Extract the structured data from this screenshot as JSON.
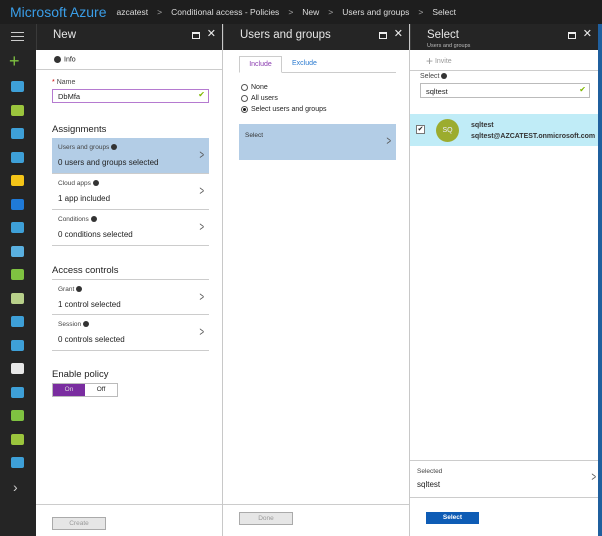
{
  "topbar": {
    "brand": "Microsoft Azure",
    "breadcrumbs": [
      "azcatest",
      "Conditional access - Policies",
      "New",
      "Users and groups",
      "Select"
    ]
  },
  "sidebar": {
    "icons": [
      {
        "name": "dashboard-icon",
        "color": "#3ea0d8"
      },
      {
        "name": "all-resources-icon",
        "color": "#9bc53d"
      },
      {
        "name": "resource-groups-icon",
        "color": "#3ea0d8"
      },
      {
        "name": "app-services-icon",
        "color": "#3ea0d8"
      },
      {
        "name": "function-apps-icon",
        "color": "#f5c518"
      },
      {
        "name": "sql-databases-icon",
        "color": "#1f7ad8"
      },
      {
        "name": "cosmos-db-icon",
        "color": "#3ea0d8"
      },
      {
        "name": "virtual-machines-icon",
        "color": "#5ab0e0"
      },
      {
        "name": "load-balancers-icon",
        "color": "#7fc241"
      },
      {
        "name": "storage-accounts-icon",
        "color": "#b8d08a"
      },
      {
        "name": "virtual-networks-icon",
        "color": "#3ea0d8"
      },
      {
        "name": "azure-ad-icon",
        "color": "#3ea0d8"
      },
      {
        "name": "monitor-icon",
        "color": "#e8e8e8"
      },
      {
        "name": "advisor-icon",
        "color": "#3ea0d8"
      },
      {
        "name": "security-center-icon",
        "color": "#7fc241"
      },
      {
        "name": "cost-management-icon",
        "color": "#9bc53d"
      },
      {
        "name": "help-support-icon",
        "color": "#3ea0d8"
      }
    ],
    "expand": "›"
  },
  "new_panel": {
    "title": "New",
    "info": "Info",
    "name_label": "Name",
    "name_value": "DbMfa",
    "assignments": "Assignments",
    "items": [
      {
        "label": "Users and groups",
        "value": "0 users and groups selected"
      },
      {
        "label": "Cloud apps",
        "value": "1 app included"
      },
      {
        "label": "Conditions",
        "value": "0 conditions selected"
      }
    ],
    "access_controls": "Access controls",
    "controls": [
      {
        "label": "Grant",
        "value": "1 control selected"
      },
      {
        "label": "Session",
        "value": "0 controls selected"
      }
    ],
    "enable_policy": "Enable policy",
    "on": "On",
    "off": "Off",
    "create": "Create"
  },
  "ug_panel": {
    "title": "Users and groups",
    "tabs": [
      "Include",
      "Exclude"
    ],
    "options": [
      "None",
      "All users",
      "Select users and groups"
    ],
    "select": "Select",
    "done": "Done"
  },
  "select_panel": {
    "title": "Select",
    "subtitle": "Users and groups",
    "invite": "Invite",
    "select_label": "Select",
    "search_value": "sqltest",
    "result": {
      "initials": "SQ",
      "name": "sqltest",
      "email": "sqltest@AZCATEST.onmicrosoft.com"
    },
    "selected_label": "Selected",
    "selected_value": "sqltest",
    "select_button": "Select"
  },
  "colors": {
    "accent": "#7a2da0",
    "highlight": "#b3cde6",
    "result_bg": "#c0ecf7",
    "button_blue": "#0e5cb5"
  }
}
